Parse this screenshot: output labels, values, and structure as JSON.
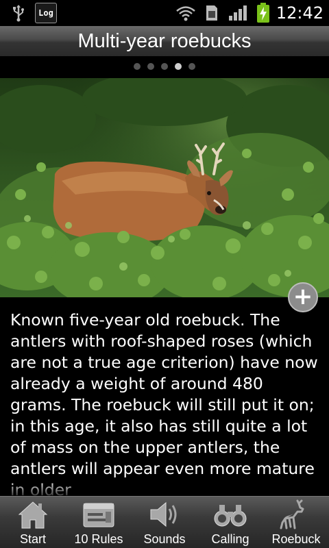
{
  "status_bar": {
    "log_label": "Log",
    "time": "12:42",
    "icons": [
      "usb-icon",
      "wifi-icon",
      "sim-icon",
      "signal-icon",
      "battery-charging-icon"
    ]
  },
  "header": {
    "title": "Multi-year roebucks",
    "page_indicator": {
      "count": 5,
      "active_index": 3
    }
  },
  "photo": {
    "alt": "Roebuck in green foliage",
    "zoom_icon": "plus-icon"
  },
  "description": {
    "text": "Known five-year old roebuck. The antlers with roof-shaped roses (which are not a true age criterion) have now already a weight of around 480 grams. The roebuck will still put it on; in this age, it also has still quite a lot of mass on the upper antlers, the antlers will appear even more mature in older"
  },
  "tabs": [
    {
      "label": "Start",
      "icon": "home-icon"
    },
    {
      "label": "10 Rules",
      "icon": "rules-icon"
    },
    {
      "label": "Sounds",
      "icon": "speaker-icon"
    },
    {
      "label": "Calling",
      "icon": "binoculars-icon"
    },
    {
      "label": "Roebuck",
      "icon": "deer-icon"
    }
  ],
  "colors": {
    "background": "#000000",
    "bar_gradient_top": "#6a6a6a",
    "bar_gradient_bottom": "#2a2a2a",
    "foliage": "#3e6b27"
  }
}
